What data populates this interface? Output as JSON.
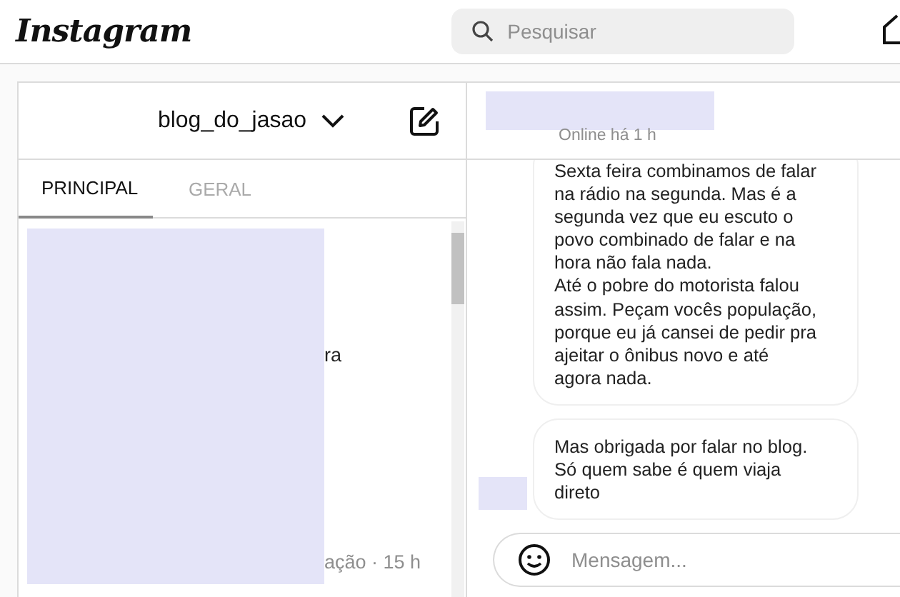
{
  "header": {
    "logo": "Instagram",
    "search": {
      "placeholder": "Pesquisar"
    }
  },
  "inbox": {
    "account": "blog_do_jasao",
    "tabs": [
      {
        "label": "PRINCIPAL",
        "selected": true
      },
      {
        "label": "GERAL",
        "selected": false
      }
    ],
    "list_fragments": [
      "ra",
      "ação · 15 h"
    ]
  },
  "chat": {
    "status": "Online há 1 h",
    "messages": [
      {
        "text": "Sexta feira combinamos de falar\nna rádio na segunda. Mas é a\nsegunda vez que eu escuto o\npovo combinado de falar e na\nhora não fala nada.\nAté o pobre do motorista falou\nassim. Peçam vocês população,\nporque eu já cansei de pedir pra\najeitar o ônibus novo e até\nagora nada."
      },
      {
        "text": "Mas obrigada por falar no blog.\nSó quem sabe é quem viaja\ndireto"
      }
    ],
    "composer": {
      "placeholder": "Mensagem..."
    }
  }
}
